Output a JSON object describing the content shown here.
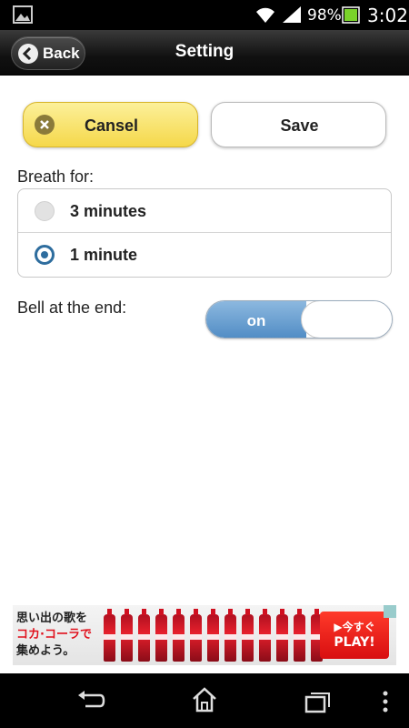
{
  "status_bar": {
    "battery_percent": "98%",
    "time": "3:02",
    "icons": [
      "image-icon",
      "wifi-icon",
      "signal-icon",
      "battery-icon"
    ]
  },
  "header": {
    "back_label": "Back",
    "title": "Setting"
  },
  "actions": {
    "cancel_label": "Cansel",
    "save_label": "Save"
  },
  "breath": {
    "label": "Breath for:",
    "options": [
      {
        "label": "3 minutes",
        "selected": false
      },
      {
        "label": "1 minute",
        "selected": true
      }
    ]
  },
  "bell": {
    "label": "Bell at the end:",
    "toggle_label": "on",
    "state": "on"
  },
  "ad": {
    "line1": "思い出の歌を",
    "line2": "コカ·コーラで",
    "line3": "集めよう。",
    "cta_line1": "▶今すぐ",
    "cta_line2": "PLAY!"
  },
  "colors": {
    "cancel_button": "#f5d84a",
    "toggle_on": "#4f8bc4",
    "radio_selected": "#2e6d9e"
  }
}
